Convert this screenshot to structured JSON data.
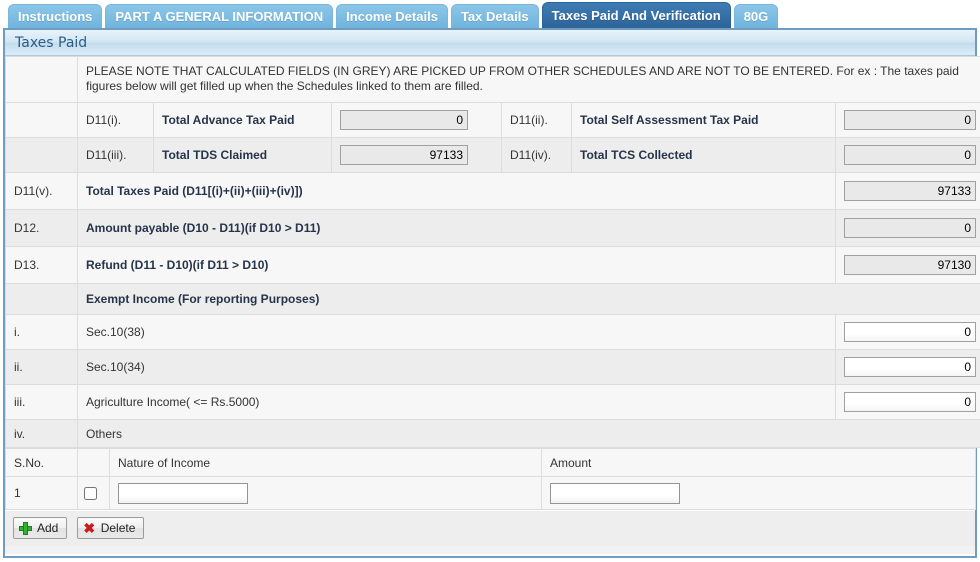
{
  "tabs": [
    {
      "label": "Instructions",
      "active": false
    },
    {
      "label": "PART A GENERAL INFORMATION",
      "active": false
    },
    {
      "label": "Income Details",
      "active": false
    },
    {
      "label": "Tax Details",
      "active": false
    },
    {
      "label": "Taxes Paid And Verification",
      "active": true
    },
    {
      "label": "80G",
      "active": false
    }
  ],
  "panel": {
    "title": "Taxes Paid"
  },
  "note": "PLEASE NOTE THAT CALCULATED FIELDS (IN GREY) ARE PICKED UP FROM OTHER SCHEDULES AND ARE NOT TO BE ENTERED. For ex : The taxes paid figures below will get filled up when the Schedules linked to them are filled.",
  "paired_rows": [
    {
      "left_code": "D11(i).",
      "left_label": "Total Advance Tax Paid",
      "left_value": "0",
      "right_code": "D11(ii).",
      "right_label": "Total Self Assessment Tax Paid",
      "right_value": "0"
    },
    {
      "left_code": "D11(iii).",
      "left_label": "Total TDS Claimed",
      "left_value": "97133",
      "right_code": "D11(iv).",
      "right_label": "Total TCS Collected",
      "right_value": "0"
    }
  ],
  "total_rows": [
    {
      "code": "D11(v).",
      "label": "Total Taxes Paid (D11[(i)+(ii)+(iii)+(iv)])",
      "value": "97133"
    },
    {
      "code": "D12.",
      "label": "Amount payable (D10 - D11)(if D10 > D11)",
      "value": "0"
    },
    {
      "code": "D13.",
      "label": "Refund (D11 - D10)(if D11 > D10)",
      "value": "97130"
    }
  ],
  "exempt": {
    "heading": "Exempt Income (For reporting Purposes)",
    "rows": [
      {
        "code": "i.",
        "label": "Sec.10(38)",
        "value": "0"
      },
      {
        "code": "ii.",
        "label": "Sec.10(34)",
        "value": "0"
      },
      {
        "code": "iii.",
        "label": "Agriculture Income( <= Rs.5000)",
        "value": "0"
      }
    ],
    "others": {
      "code": "iv.",
      "label": "Others"
    }
  },
  "others_table": {
    "columns": {
      "sno": "S.No.",
      "select": "",
      "nature": "Nature of Income",
      "amount": "Amount"
    },
    "rows": [
      {
        "sno": "1",
        "checked": false,
        "nature": "",
        "amount": ""
      }
    ]
  },
  "buttons": {
    "add": "Add",
    "delete": "Delete"
  }
}
